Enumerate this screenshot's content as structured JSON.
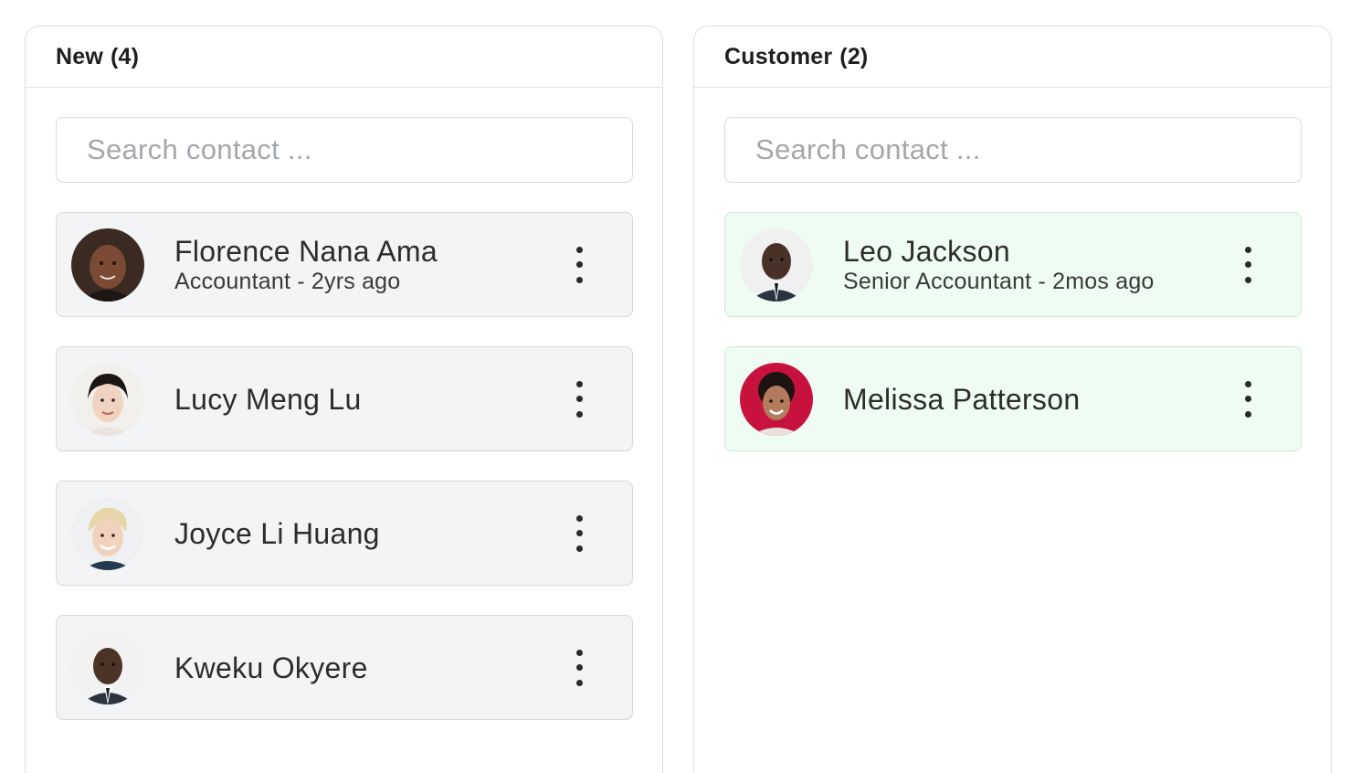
{
  "columns": [
    {
      "title": "New",
      "count": "(4)",
      "search_placeholder": "Search contact ...",
      "contacts": [
        {
          "name": "Florence Nana Ama",
          "subtitle": "Accountant - 2yrs ago"
        },
        {
          "name": "Lucy Meng Lu",
          "subtitle": ""
        },
        {
          "name": "Joyce Li Huang",
          "subtitle": ""
        },
        {
          "name": "Kweku Okyere",
          "subtitle": ""
        }
      ]
    },
    {
      "title": "Customer",
      "count": "(2)",
      "search_placeholder": "Search contact ...",
      "contacts": [
        {
          "name": "Leo Jackson",
          "subtitle": "Senior Accountant - 2mos ago"
        },
        {
          "name": "Melissa Patterson",
          "subtitle": ""
        }
      ]
    }
  ],
  "icons": {
    "more_menu": "vertical-ellipsis-icon"
  },
  "colors": {
    "new_card_bg": "#f3f4f6",
    "customer_card_bg": "#effcf3",
    "border": "#dcdfe3"
  }
}
